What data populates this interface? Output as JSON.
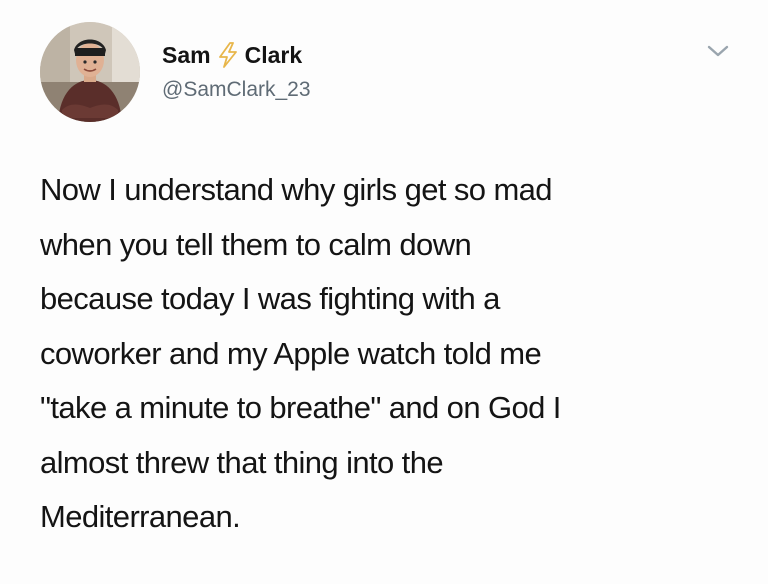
{
  "tweet": {
    "author": {
      "first_name": "Sam",
      "last_name": "Clark",
      "handle": "@SamClark_23",
      "name_separator_icon": "lightning-bolt-icon"
    },
    "menu_icon": "chevron-down-icon",
    "text_lines": [
      "Now I understand why girls get so mad",
      "when you tell them to calm down",
      "because today I was fighting with a",
      "coworker and my Apple watch told me",
      "\"take a minute to breathe\" and on God I",
      "almost threw that thing into the",
      "Mediterranean."
    ]
  },
  "colors": {
    "bolt": "#e8b64a",
    "handle": "#5f6b75",
    "chevron": "#9aa5ae"
  }
}
